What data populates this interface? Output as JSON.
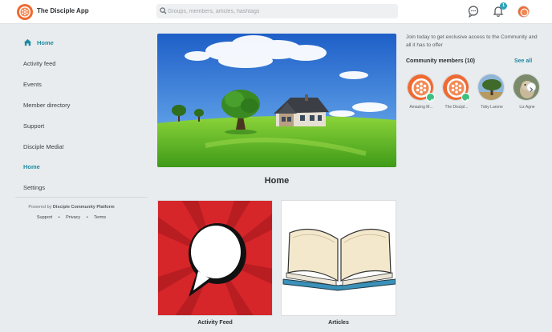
{
  "header": {
    "app_title": "The Disciple App",
    "search_placeholder": "Groups, members, articles, hashtags",
    "notification_count": "1"
  },
  "sidebar": {
    "items": [
      {
        "label": "Home"
      },
      {
        "label": "Activity feed"
      },
      {
        "label": "Events"
      },
      {
        "label": "Member directory"
      },
      {
        "label": "Support"
      },
      {
        "label": "Disciple Media!"
      },
      {
        "label": "Home"
      },
      {
        "label": "Settings"
      }
    ],
    "powered_prefix": "Powered by",
    "powered_name": "Disciple Community Platform",
    "links": [
      "Support",
      "Privacy",
      "Terms"
    ],
    "link_separator": "•"
  },
  "main": {
    "page_title": "Home",
    "cards": [
      {
        "label": "Activity Feed",
        "icon": "speech-bubble-icon"
      },
      {
        "label": "Articles",
        "icon": "open-book-icon"
      }
    ]
  },
  "community": {
    "join_text": "Join today to get exclusive access to the Community and all it has to offer",
    "title": "Community members (10)",
    "see_all": "See all",
    "members": [
      {
        "name": "Amazing M...",
        "verified": true
      },
      {
        "name": "The Discipl...",
        "verified": true
      },
      {
        "name": "Toby Larone",
        "verified": false
      },
      {
        "name": "Liz Agne",
        "verified": false
      }
    ]
  },
  "colors": {
    "accent": "#1f8aa0",
    "brand": "#ee6a32",
    "activity_card": "#d6262a",
    "verified": "#3fbf7f"
  }
}
